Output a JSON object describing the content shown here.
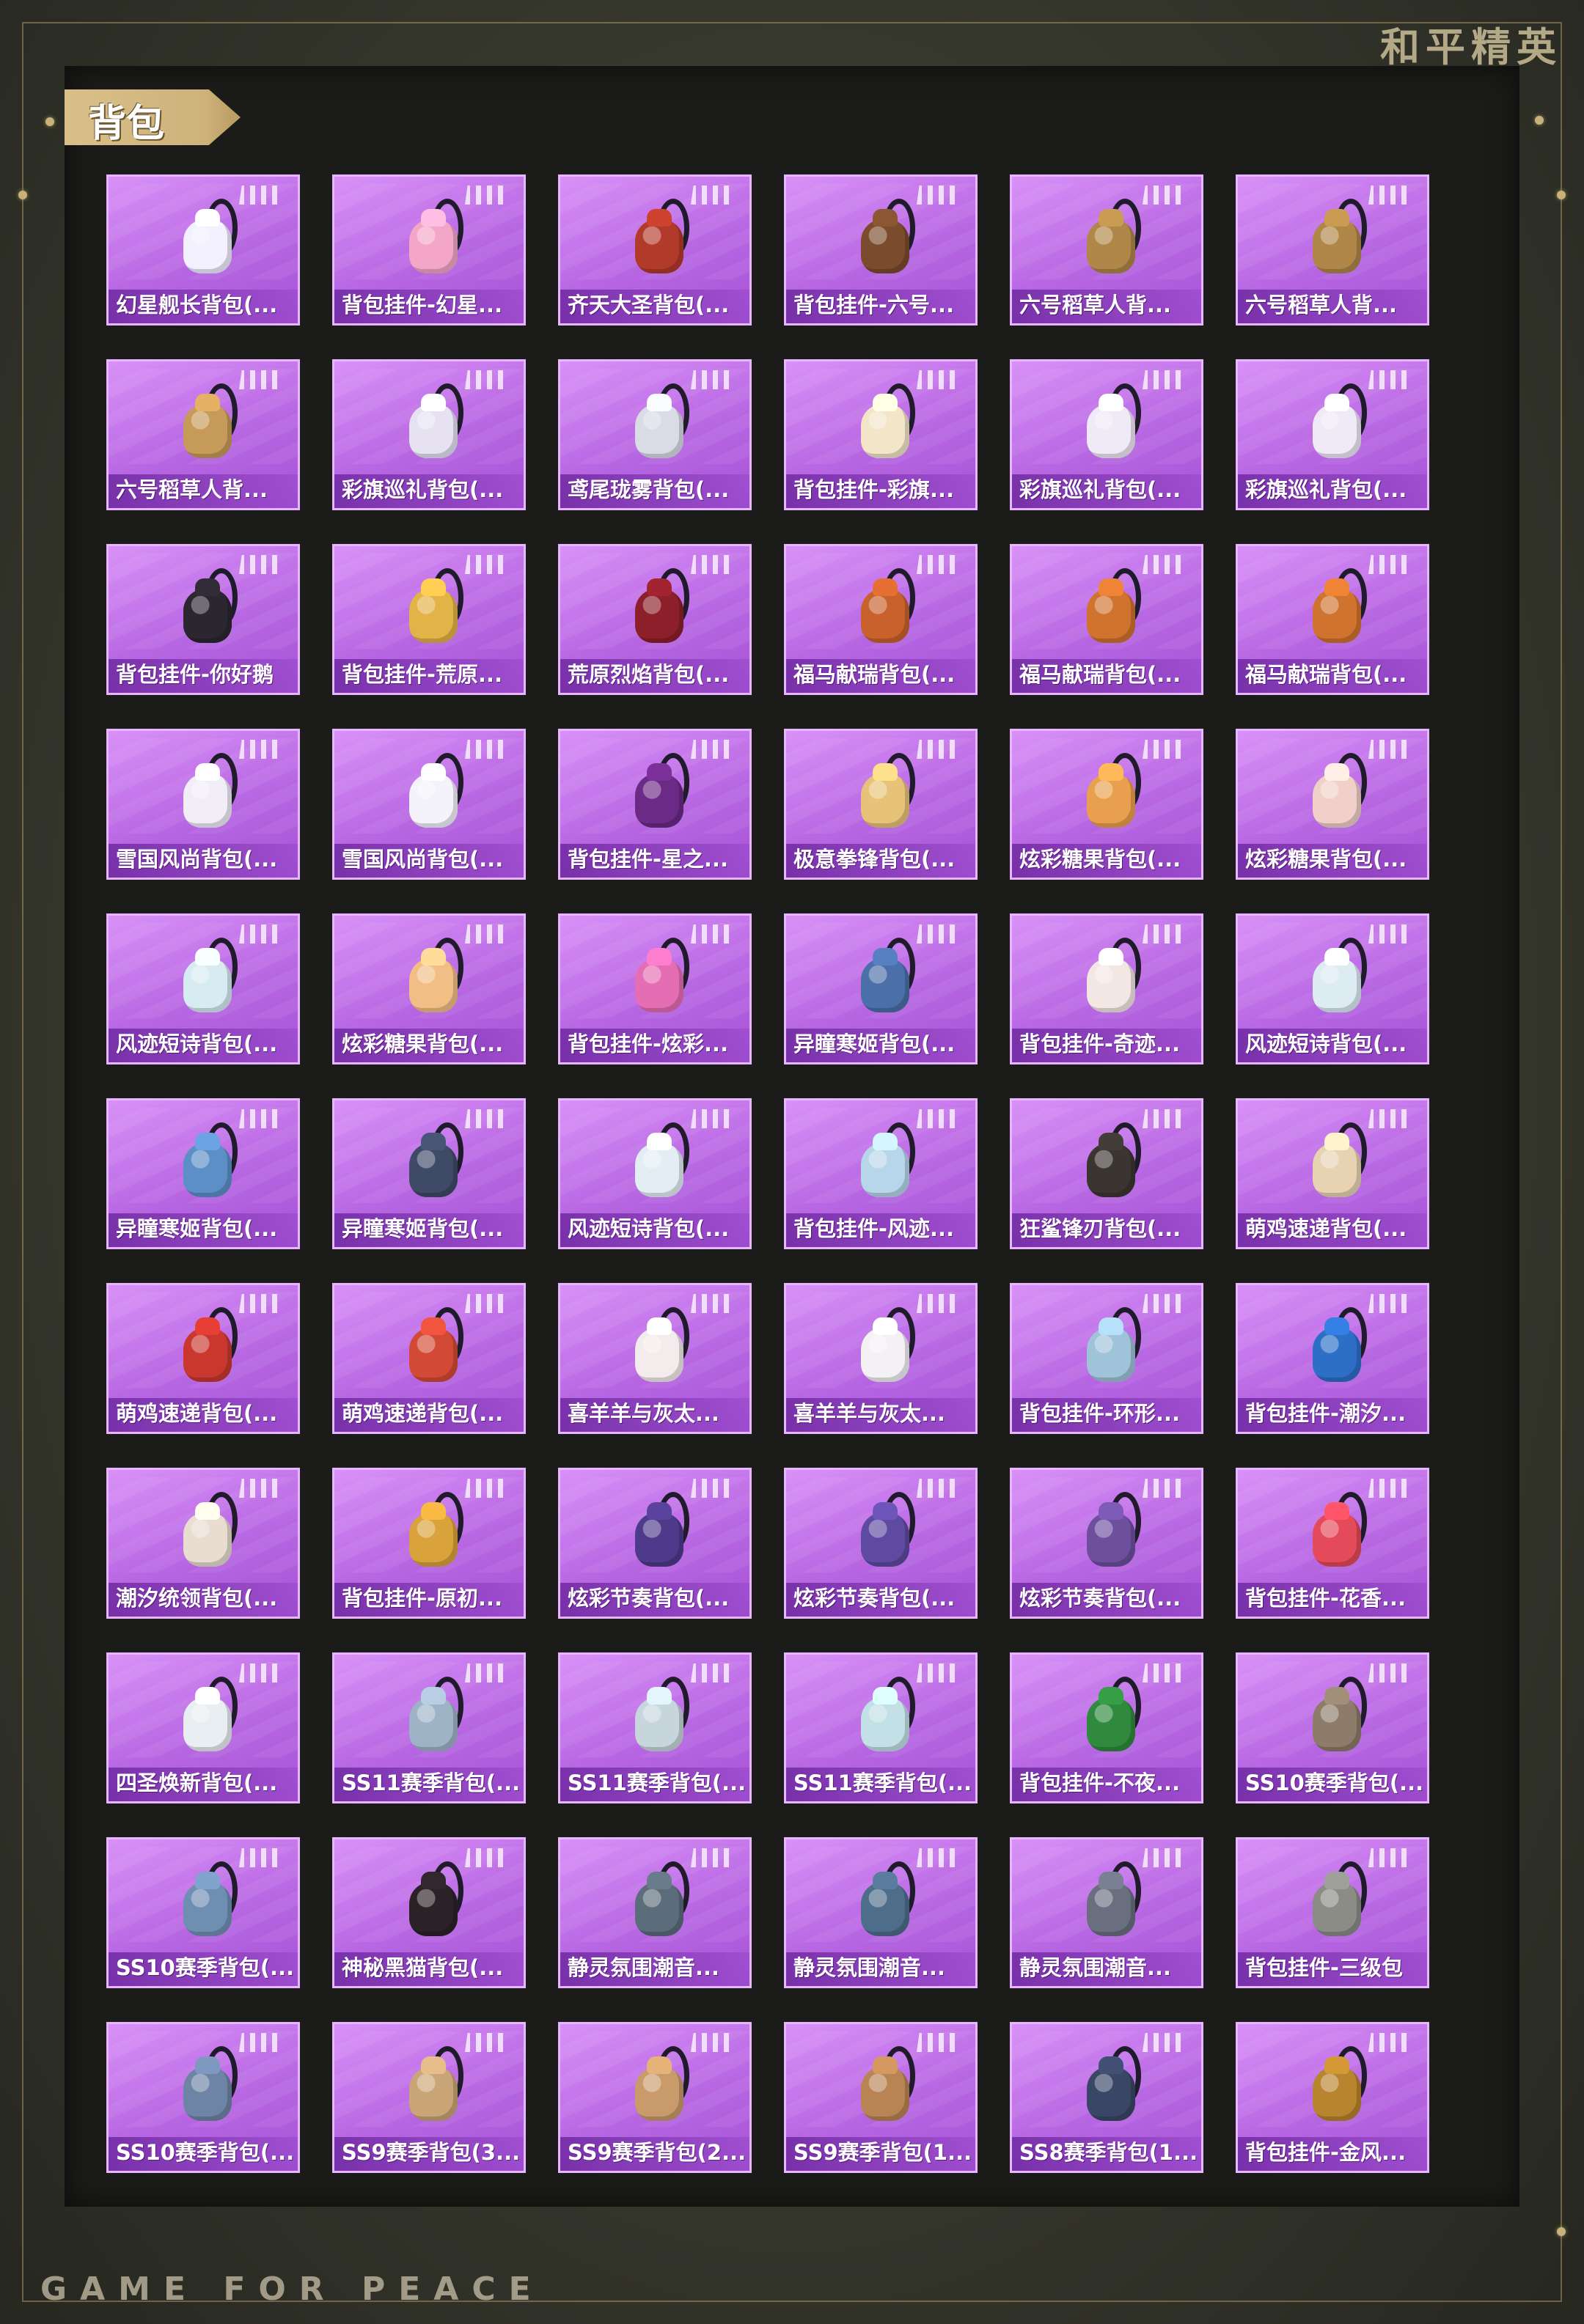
{
  "brand": "和平精英",
  "footer": "GAME FOR PEACE",
  "section_title": "背包",
  "items": [
    {
      "label": "幻星舰长背包(...",
      "color": "#f3f0ff"
    },
    {
      "label": "背包挂件-幻星...",
      "color": "#f3a6c6"
    },
    {
      "label": "齐天大圣背包(...",
      "color": "#b23a2a"
    },
    {
      "label": "背包挂件-六号...",
      "color": "#7a4b2c"
    },
    {
      "label": "六号稻草人背...",
      "color": "#b08748"
    },
    {
      "label": "六号稻草人背...",
      "color": "#b08748"
    },
    {
      "label": "六号稻草人背...",
      "color": "#c69a58"
    },
    {
      "label": "彩旗巡礼背包(...",
      "color": "#e6e2f2"
    },
    {
      "label": "鸢尾珑雾背包(...",
      "color": "#d9dbe6"
    },
    {
      "label": "背包挂件-彩旗...",
      "color": "#f2e5c8"
    },
    {
      "label": "彩旗巡礼背包(...",
      "color": "#efeaf6"
    },
    {
      "label": "彩旗巡礼背包(...",
      "color": "#efeaf6"
    },
    {
      "label": "背包挂件-你好鹅",
      "color": "#2b2630"
    },
    {
      "label": "背包挂件-荒原...",
      "color": "#e2b347"
    },
    {
      "label": "荒原烈焰背包(...",
      "color": "#8c1f2a"
    },
    {
      "label": "福马献瑞背包(...",
      "color": "#c8612c"
    },
    {
      "label": "福马献瑞背包(...",
      "color": "#d0732f"
    },
    {
      "label": "福马献瑞背包(...",
      "color": "#d0732f"
    },
    {
      "label": "雪国风尚背包(...",
      "color": "#f2eef8"
    },
    {
      "label": "雪国风尚背包(...",
      "color": "#f5f3fa"
    },
    {
      "label": "背包挂件-星之...",
      "color": "#6b2a86"
    },
    {
      "label": "极意拳锋背包(...",
      "color": "#e7c37a"
    },
    {
      "label": "炫彩糖果背包(...",
      "color": "#e9a04e"
    },
    {
      "label": "炫彩糖果背包(...",
      "color": "#f0d0c8"
    },
    {
      "label": "风迹短诗背包(...",
      "color": "#d7ecf2"
    },
    {
      "label": "炫彩糖果背包(...",
      "color": "#f1bf86"
    },
    {
      "label": "背包挂件-炫彩...",
      "color": "#e56db4"
    },
    {
      "label": "异瞳寒姬背包(...",
      "color": "#4b6fa8"
    },
    {
      "label": "背包挂件-奇迹...",
      "color": "#f3e7e4"
    },
    {
      "label": "风迹短诗背包(...",
      "color": "#dcecf2"
    },
    {
      "label": "异瞳寒姬背包(...",
      "color": "#5c8fc6"
    },
    {
      "label": "异瞳寒姬背包(...",
      "color": "#3f4a66"
    },
    {
      "label": "风迹短诗背包(...",
      "color": "#e2eef4"
    },
    {
      "label": "背包挂件-风迹...",
      "color": "#b8d6ea"
    },
    {
      "label": "狂鲨锋刃背包(...",
      "color": "#3a3530"
    },
    {
      "label": "萌鸡速递背包(...",
      "color": "#e7d3b2"
    },
    {
      "label": "萌鸡速递背包(...",
      "color": "#c9372f"
    },
    {
      "label": "萌鸡速递背包(...",
      "color": "#d24a35"
    },
    {
      "label": "喜羊羊与灰太...",
      "color": "#f4ecec"
    },
    {
      "label": "喜羊羊与灰太...",
      "color": "#f4f1f4"
    },
    {
      "label": "背包挂件-环形...",
      "color": "#9fc3d9"
    },
    {
      "label": "背包挂件-潮汐...",
      "color": "#2d6fc6"
    },
    {
      "label": "潮汐统领背包(...",
      "color": "#e8ddd0"
    },
    {
      "label": "背包挂件-原初...",
      "color": "#d9a23a"
    },
    {
      "label": "炫彩节奏背包(...",
      "color": "#4d3a8a"
    },
    {
      "label": "炫彩节奏背包(...",
      "color": "#5f4aa2"
    },
    {
      "label": "炫彩节奏背包(...",
      "color": "#6d4f9e"
    },
    {
      "label": "背包挂件-花香...",
      "color": "#e54a5a"
    },
    {
      "label": "四圣焕新背包(...",
      "color": "#e9eef2"
    },
    {
      "label": "SS11赛季背包(...",
      "color": "#9fb3c6"
    },
    {
      "label": "SS11赛季背包(...",
      "color": "#c7d5dd"
    },
    {
      "label": "SS11赛季背包(...",
      "color": "#c2e0e6"
    },
    {
      "label": "背包挂件-不夜...",
      "color": "#2f8a3d"
    },
    {
      "label": "SS10赛季背包(...",
      "color": "#8d7c6a"
    },
    {
      "label": "SS10赛季背包(...",
      "color": "#6f8fb2"
    },
    {
      "label": "神秘黑猫背包(...",
      "color": "#2b2227"
    },
    {
      "label": "静灵氛围潮音...",
      "color": "#5b6c7a"
    },
    {
      "label": "静灵氛围潮音...",
      "color": "#4e6d8a"
    },
    {
      "label": "静灵氛围潮音...",
      "color": "#6a6f80"
    },
    {
      "label": "背包挂件-三级包",
      "color": "#8a8c85"
    },
    {
      "label": "SS10赛季背包(...",
      "color": "#6e84a6"
    },
    {
      "label": "SS9赛季背包(3...",
      "color": "#c9a577"
    },
    {
      "label": "SS9赛季背包(2...",
      "color": "#c99a6a"
    },
    {
      "label": "SS9赛季背包(1...",
      "color": "#b98454"
    },
    {
      "label": "SS8赛季背包(1...",
      "color": "#3a4666"
    },
    {
      "label": "背包挂件-金风...",
      "color": "#b8842e"
    }
  ]
}
